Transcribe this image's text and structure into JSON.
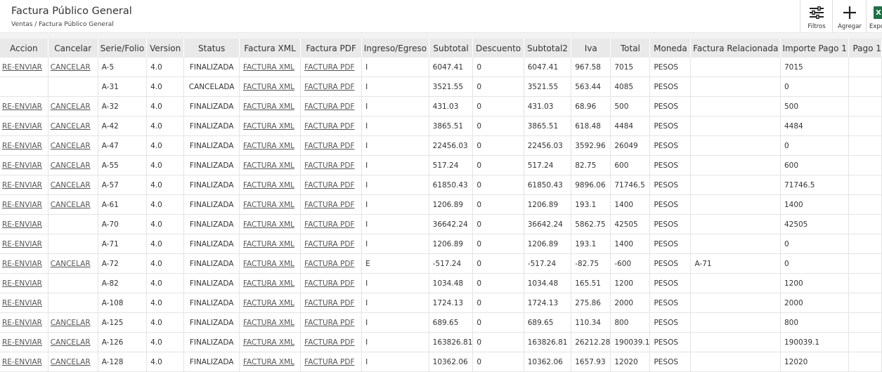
{
  "page": {
    "title": "Factura Público General",
    "breadcrumb": "Ventas / Factura Público General"
  },
  "toolbar": {
    "filters_label": "Filtros",
    "add_label": "Agregar",
    "export_label": "Expo",
    "export_icon_letter": "X"
  },
  "table": {
    "columns": [
      "Accion",
      "Cancelar",
      "Serie/Folio",
      "Version",
      "Status",
      "Factura XML",
      "Factura PDF",
      "Ingreso/Egreso",
      "Subtotal",
      "Descuento",
      "Subtotal2",
      "Iva",
      "Total",
      "Moneda",
      "Factura Relacionada",
      "Importe Pago 1",
      "Pago 1"
    ],
    "rows": [
      {
        "accion": "RE-ENVIAR",
        "cancelar": "CANCELAR",
        "folio": "A-5",
        "version": "4.0",
        "status": "FINALIZADA",
        "xml": "FACTURA XML",
        "pdf": "FACTURA PDF",
        "tipo": "I",
        "subtotal": "6047.41",
        "descuento": "0",
        "subtotal2": "6047.41",
        "iva": "967.58",
        "total": "7015",
        "moneda": "PESOS",
        "relacionada": "",
        "importe": "7015"
      },
      {
        "accion": "",
        "cancelar": "",
        "folio": "A-31",
        "version": "4.0",
        "status": "CANCELADA",
        "xml": "FACTURA XML",
        "pdf": "FACTURA PDF",
        "tipo": "I",
        "subtotal": "3521.55",
        "descuento": "0",
        "subtotal2": "3521.55",
        "iva": "563.44",
        "total": "4085",
        "moneda": "PESOS",
        "relacionada": "",
        "importe": "0"
      },
      {
        "accion": "RE-ENVIAR",
        "cancelar": "CANCELAR",
        "folio": "A-32",
        "version": "4.0",
        "status": "FINALIZADA",
        "xml": "FACTURA XML",
        "pdf": "FACTURA PDF",
        "tipo": "I",
        "subtotal": "431.03",
        "descuento": "0",
        "subtotal2": "431.03",
        "iva": "68.96",
        "total": "500",
        "moneda": "PESOS",
        "relacionada": "",
        "importe": "500"
      },
      {
        "accion": "RE-ENVIAR",
        "cancelar": "CANCELAR",
        "folio": "A-42",
        "version": "4.0",
        "status": "FINALIZADA",
        "xml": "FACTURA XML",
        "pdf": "FACTURA PDF",
        "tipo": "I",
        "subtotal": "3865.51",
        "descuento": "0",
        "subtotal2": "3865.51",
        "iva": "618.48",
        "total": "4484",
        "moneda": "PESOS",
        "relacionada": "",
        "importe": "4484"
      },
      {
        "accion": "RE-ENVIAR",
        "cancelar": "CANCELAR",
        "folio": "A-47",
        "version": "4.0",
        "status": "FINALIZADA",
        "xml": "FACTURA XML",
        "pdf": "FACTURA PDF",
        "tipo": "I",
        "subtotal": "22456.03",
        "descuento": "0",
        "subtotal2": "22456.03",
        "iva": "3592.96",
        "total": "26049",
        "moneda": "PESOS",
        "relacionada": "",
        "importe": "0"
      },
      {
        "accion": "RE-ENVIAR",
        "cancelar": "CANCELAR",
        "folio": "A-55",
        "version": "4.0",
        "status": "FINALIZADA",
        "xml": "FACTURA XML",
        "pdf": "FACTURA PDF",
        "tipo": "I",
        "subtotal": "517.24",
        "descuento": "0",
        "subtotal2": "517.24",
        "iva": "82.75",
        "total": "600",
        "moneda": "PESOS",
        "relacionada": "",
        "importe": "600"
      },
      {
        "accion": "RE-ENVIAR",
        "cancelar": "CANCELAR",
        "folio": "A-57",
        "version": "4.0",
        "status": "FINALIZADA",
        "xml": "FACTURA XML",
        "pdf": "FACTURA PDF",
        "tipo": "I",
        "subtotal": "61850.43",
        "descuento": "0",
        "subtotal2": "61850.43",
        "iva": "9896.06",
        "total": "71746.5",
        "moneda": "PESOS",
        "relacionada": "",
        "importe": "71746.5"
      },
      {
        "accion": "RE-ENVIAR",
        "cancelar": "CANCELAR",
        "folio": "A-61",
        "version": "4.0",
        "status": "FINALIZADA",
        "xml": "FACTURA XML",
        "pdf": "FACTURA PDF",
        "tipo": "I",
        "subtotal": "1206.89",
        "descuento": "0",
        "subtotal2": "1206.89",
        "iva": "193.1",
        "total": "1400",
        "moneda": "PESOS",
        "relacionada": "",
        "importe": "1400"
      },
      {
        "accion": "RE-ENVIAR",
        "cancelar": "",
        "folio": "A-70",
        "version": "4.0",
        "status": "FINALIZADA",
        "xml": "FACTURA XML",
        "pdf": "FACTURA PDF",
        "tipo": "I",
        "subtotal": "36642.24",
        "descuento": "0",
        "subtotal2": "36642.24",
        "iva": "5862.75",
        "total": "42505",
        "moneda": "PESOS",
        "relacionada": "",
        "importe": "42505"
      },
      {
        "accion": "RE-ENVIAR",
        "cancelar": "",
        "folio": "A-71",
        "version": "4.0",
        "status": "FINALIZADA",
        "xml": "FACTURA XML",
        "pdf": "FACTURA PDF",
        "tipo": "I",
        "subtotal": "1206.89",
        "descuento": "0",
        "subtotal2": "1206.89",
        "iva": "193.1",
        "total": "1400",
        "moneda": "PESOS",
        "relacionada": "",
        "importe": "0"
      },
      {
        "accion": "RE-ENVIAR",
        "cancelar": "CANCELAR",
        "folio": "A-72",
        "version": "4.0",
        "status": "FINALIZADA",
        "xml": "FACTURA XML",
        "pdf": "FACTURA PDF",
        "tipo": "E",
        "subtotal": "-517.24",
        "descuento": "0",
        "subtotal2": "-517.24",
        "iva": "-82.75",
        "total": "-600",
        "moneda": "PESOS",
        "relacionada": "A-71",
        "importe": "0"
      },
      {
        "accion": "RE-ENVIAR",
        "cancelar": "",
        "folio": "A-82",
        "version": "4.0",
        "status": "FINALIZADA",
        "xml": "FACTURA XML",
        "pdf": "FACTURA PDF",
        "tipo": "I",
        "subtotal": "1034.48",
        "descuento": "0",
        "subtotal2": "1034.48",
        "iva": "165.51",
        "total": "1200",
        "moneda": "PESOS",
        "relacionada": "",
        "importe": "1200"
      },
      {
        "accion": "RE-ENVIAR",
        "cancelar": "",
        "folio": "A-108",
        "version": "4.0",
        "status": "FINALIZADA",
        "xml": "FACTURA XML",
        "pdf": "FACTURA PDF",
        "tipo": "I",
        "subtotal": "1724.13",
        "descuento": "0",
        "subtotal2": "1724.13",
        "iva": "275.86",
        "total": "2000",
        "moneda": "PESOS",
        "relacionada": "",
        "importe": "2000"
      },
      {
        "accion": "RE-ENVIAR",
        "cancelar": "CANCELAR",
        "folio": "A-125",
        "version": "4.0",
        "status": "FINALIZADA",
        "xml": "FACTURA XML",
        "pdf": "FACTURA PDF",
        "tipo": "I",
        "subtotal": "689.65",
        "descuento": "0",
        "subtotal2": "689.65",
        "iva": "110.34",
        "total": "800",
        "moneda": "PESOS",
        "relacionada": "",
        "importe": "800"
      },
      {
        "accion": "RE-ENVIAR",
        "cancelar": "CANCELAR",
        "folio": "A-126",
        "version": "4.0",
        "status": "FINALIZADA",
        "xml": "FACTURA XML",
        "pdf": "FACTURA PDF",
        "tipo": "I",
        "subtotal": "163826.81",
        "descuento": "0",
        "subtotal2": "163826.81",
        "iva": "26212.28",
        "total": "190039.1",
        "moneda": "PESOS",
        "relacionada": "",
        "importe": "190039.1"
      },
      {
        "accion": "RE-ENVIAR",
        "cancelar": "CANCELAR",
        "folio": "A-128",
        "version": "4.0",
        "status": "FINALIZADA",
        "xml": "FACTURA XML",
        "pdf": "FACTURA PDF",
        "tipo": "I",
        "subtotal": "10362.06",
        "descuento": "0",
        "subtotal2": "10362.06",
        "iva": "1657.93",
        "total": "12020",
        "moneda": "PESOS",
        "relacionada": "",
        "importe": "12020"
      }
    ]
  }
}
